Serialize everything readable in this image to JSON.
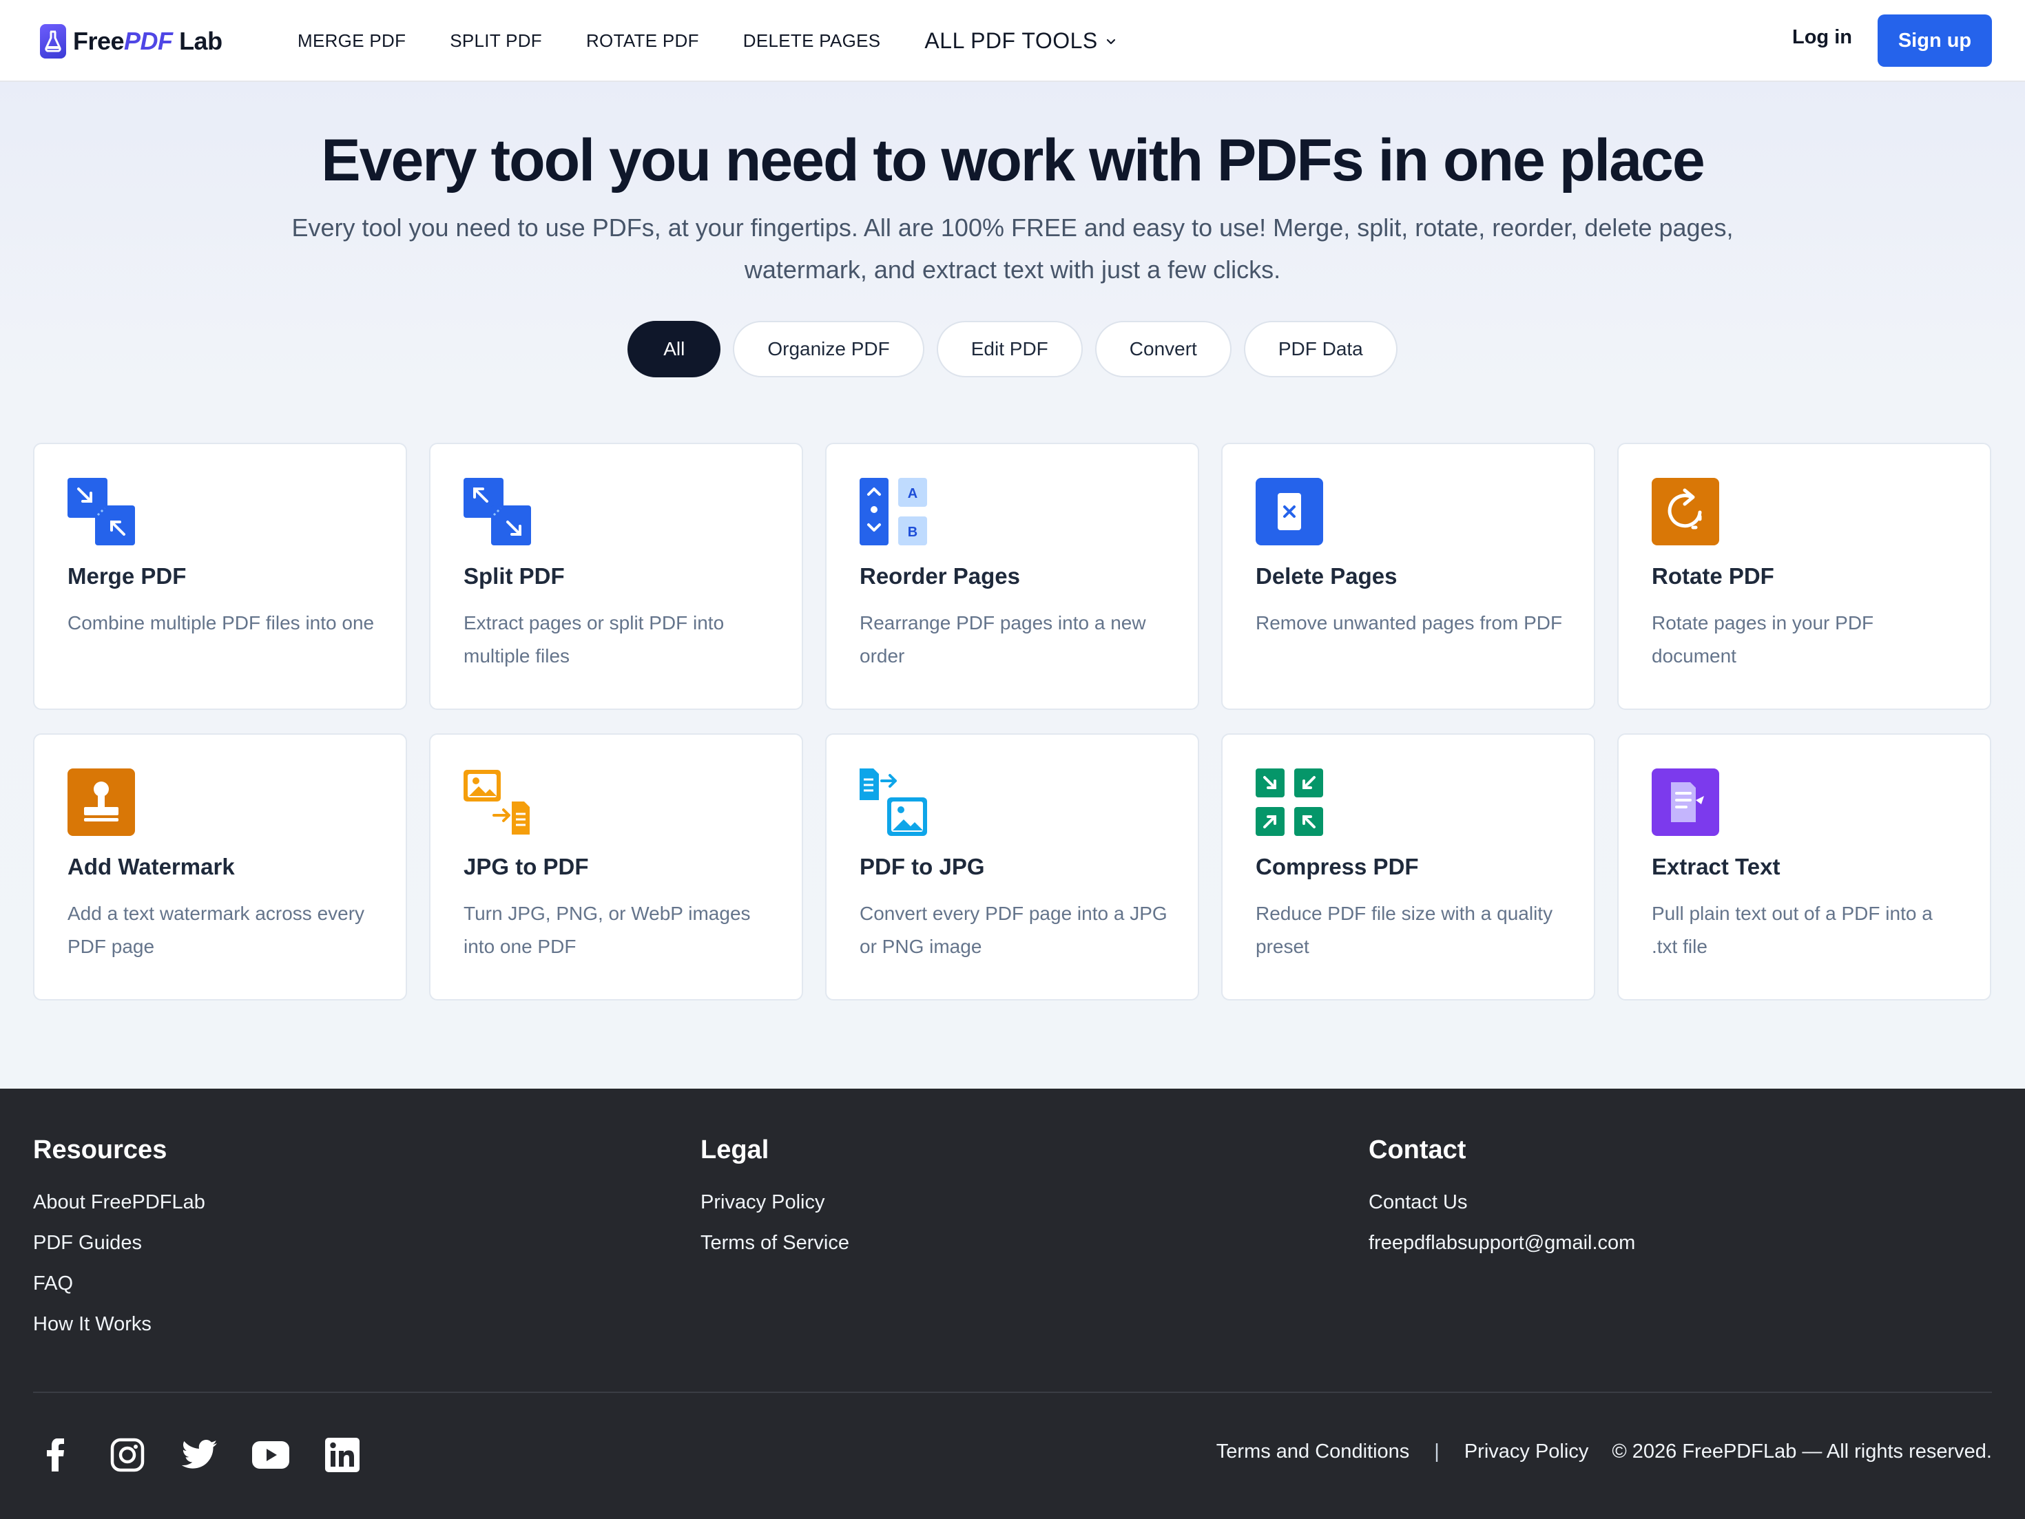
{
  "brand": {
    "free": "Free",
    "pdf": "PDF",
    "lab": "Lab"
  },
  "nav": {
    "items": [
      "MERGE PDF",
      "SPLIT PDF",
      "ROTATE PDF",
      "DELETE PAGES"
    ],
    "all_tools": "ALL PDF TOOLS",
    "login": "Log in",
    "signup": "Sign up"
  },
  "hero": {
    "title": "Every tool you need to work with PDFs in one place",
    "subtitle": "Every tool you need to use PDFs, at your fingertips. All are 100% FREE and easy to use! Merge, split, rotate, reorder, delete pages, watermark, and extract text with just a few clicks."
  },
  "filters": [
    "All",
    "Organize PDF",
    "Edit PDF",
    "Convert",
    "PDF Data"
  ],
  "active_filter": "All",
  "tools": [
    {
      "title": "Merge PDF",
      "desc": "Combine multiple PDF files into one",
      "icon": "merge-icon",
      "color": "#2563eb"
    },
    {
      "title": "Split PDF",
      "desc": "Extract pages or split PDF into multiple files",
      "icon": "split-icon",
      "color": "#2563eb"
    },
    {
      "title": "Reorder Pages",
      "desc": "Rearrange PDF pages into a new order",
      "icon": "reorder-icon",
      "color": "#2563eb"
    },
    {
      "title": "Delete Pages",
      "desc": "Remove unwanted pages from PDF",
      "icon": "delete-page-icon",
      "color": "#2563eb"
    },
    {
      "title": "Rotate PDF",
      "desc": "Rotate pages in your PDF document",
      "icon": "rotate-icon",
      "color": "#d97706"
    },
    {
      "title": "Add Watermark",
      "desc": "Add a text watermark across every PDF page",
      "icon": "stamp-icon",
      "color": "#d97706"
    },
    {
      "title": "JPG to PDF",
      "desc": "Turn JPG, PNG, or WebP images into one PDF",
      "icon": "image-to-pdf-icon",
      "color": "#f59e0b"
    },
    {
      "title": "PDF to JPG",
      "desc": "Convert every PDF page into a JPG or PNG image",
      "icon": "pdf-to-image-icon",
      "color": "#0ea5e9"
    },
    {
      "title": "Compress PDF",
      "desc": "Reduce PDF file size with a quality preset",
      "icon": "compress-icon",
      "color": "#059669"
    },
    {
      "title": "Extract Text",
      "desc": "Pull plain text out of a PDF into a .txt file",
      "icon": "extract-text-icon",
      "color": "#7c3aed"
    }
  ],
  "footer": {
    "resources": {
      "title": "Resources",
      "links": [
        "About FreePDFLab",
        "PDF Guides",
        "FAQ",
        "How It Works"
      ]
    },
    "legal": {
      "title": "Legal",
      "links": [
        "Privacy Policy",
        "Terms of Service"
      ]
    },
    "contact": {
      "title": "Contact",
      "links": [
        "Contact Us",
        "freepdflabsupport@gmail.com"
      ]
    },
    "bottom": {
      "terms": "Terms and Conditions",
      "sep": "|",
      "privacy": "Privacy Policy",
      "copyright": "© 2026 FreePDFLab — All rights reserved."
    },
    "social": [
      "facebook-icon",
      "instagram-icon",
      "twitter-icon",
      "youtube-icon",
      "linkedin-icon"
    ]
  }
}
